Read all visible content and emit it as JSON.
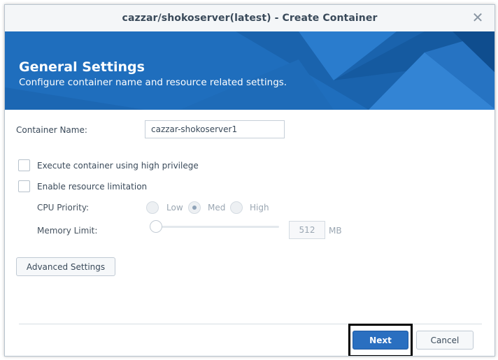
{
  "window": {
    "title": "cazzar/shokoserver(latest) - Create Container",
    "close_icon": "close-icon"
  },
  "banner": {
    "title": "General Settings",
    "subtitle": "Configure container name and resource related settings."
  },
  "form": {
    "container_name_label": "Container Name:",
    "container_name_value": "cazzar-shokoserver1",
    "high_privilege_label": "Execute container using high privilege",
    "high_privilege_checked": false,
    "resource_limit_label": "Enable resource limitation",
    "resource_limit_checked": false,
    "cpu_priority_label": "CPU Priority:",
    "cpu_options": [
      "Low",
      "Med",
      "High"
    ],
    "cpu_selected": "Med",
    "memory_limit_label": "Memory Limit:",
    "memory_value": "512",
    "memory_unit": "MB",
    "memory_slider_level": 0
  },
  "buttons": {
    "advanced": "Advanced Settings",
    "next": "Next",
    "cancel": "Cancel"
  },
  "colors": {
    "accent": "#2a6fc0",
    "banner": "#1f6ebd",
    "title_bar": "#f4f6f8"
  }
}
